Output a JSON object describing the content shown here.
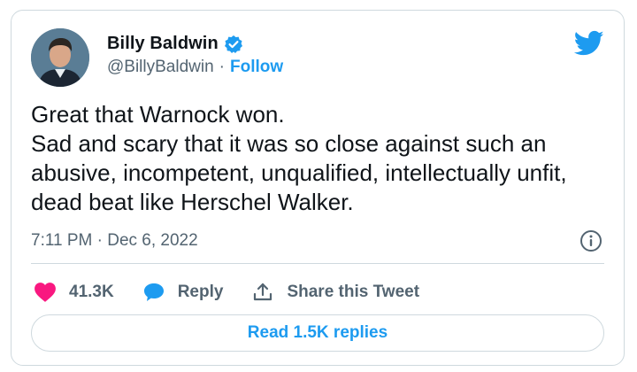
{
  "author": {
    "name": "Billy Baldwin",
    "handle": "@BillyBaldwin",
    "separator": "·",
    "follow_label": "Follow",
    "verified": true
  },
  "tweet": {
    "lines": [
      "Great that Warnock won.",
      "Sad and scary that it was so close against such an",
      "abusive, incompetent, unqualified, intellectually unfit,",
      "dead beat like Herschel Walker."
    ],
    "timestamp": "7:11 PM · Dec 6, 2022"
  },
  "actions": {
    "likes": "41.3K",
    "reply_label": "Reply",
    "share_label": "Share this Tweet"
  },
  "replies_button": "Read 1.5K replies",
  "colors": {
    "accent": "#1d9bf0",
    "heart": "#f91880",
    "muted": "#536471",
    "border": "#cfd9de"
  },
  "icons": [
    "verified-badge-icon",
    "twitter-bird-icon",
    "info-icon",
    "heart-icon",
    "reply-bubble-icon",
    "share-icon"
  ]
}
